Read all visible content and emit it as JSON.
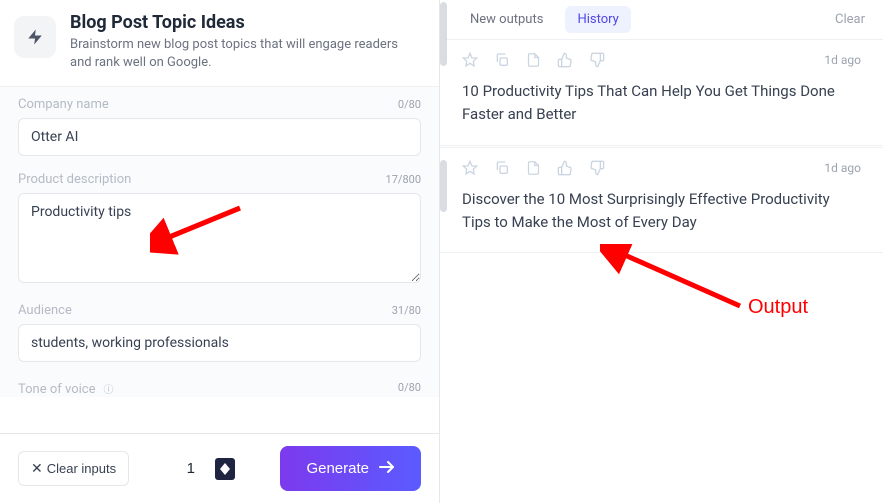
{
  "header": {
    "title": "Blog Post Topic Ideas",
    "subtitle": "Brainstorm new blog post topics that will engage readers and rank well on Google."
  },
  "fields": {
    "company": {
      "label": "Company name",
      "value": "Otter AI",
      "count": "0/80"
    },
    "description": {
      "label": "Product description",
      "value": "Productivity tips",
      "count": "17/800"
    },
    "audience": {
      "label": "Audience",
      "value": "students, working professionals",
      "count": "31/80"
    },
    "tone": {
      "label": "Tone of voice",
      "help": "ⓘ",
      "count": "0/80"
    }
  },
  "footer": {
    "clear_label": "Clear inputs",
    "quantity": "1",
    "generate_label": "Generate"
  },
  "right": {
    "tab_new": "New outputs",
    "tab_history": "History",
    "clear_label": "Clear",
    "outputs": [
      {
        "time": "1d ago",
        "text": "10 Productivity Tips That Can Help You Get Things Done Faster and Better"
      },
      {
        "time": "1d ago",
        "text": "Discover the 10 Most Surprisingly Effective Productivity Tips to Make the Most of Every Day"
      }
    ]
  },
  "annotation": {
    "output_label": "Output"
  }
}
